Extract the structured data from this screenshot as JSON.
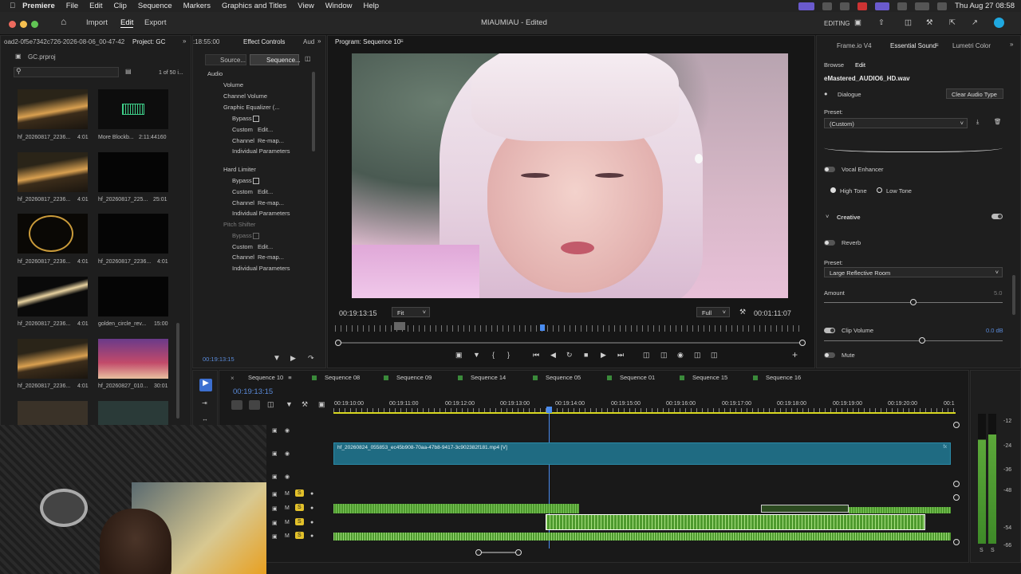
{
  "menubar": {
    "app": "Premiere",
    "items": [
      "File",
      "Edit",
      "Clip",
      "Sequence",
      "Markers",
      "Graphics and Titles",
      "View",
      "Window",
      "Help"
    ],
    "clock": "Thu Aug 27  08:58"
  },
  "titlebar": {
    "home_label": "Home",
    "import_label": "Import",
    "edit_label": "Edit",
    "export_label": "Export",
    "doc_title": "MIAUMIAU - Edited",
    "workspace": "EDITING"
  },
  "project": {
    "tab_label": "Project: GC",
    "path": "oad2-0f5e7342c726-2026-08-06_00-47-42",
    "file": "GC.prproj",
    "count": "1 of 50 i...",
    "search_placeholder": "",
    "items": [
      {
        "name": "hf_20260817_2236...",
        "dur": "4:01"
      },
      {
        "name": "More Blockb...",
        "dur": "2:11:44160"
      },
      {
        "name": "hf_20260817_2236...",
        "dur": "4:01"
      },
      {
        "name": "hf_20260817_225...",
        "dur": "25:01"
      },
      {
        "name": "hf_20260817_2236...",
        "dur": "4:01"
      },
      {
        "name": "hf_20260817_2236...",
        "dur": "4:01"
      },
      {
        "name": "hf_20260817_2236...",
        "dur": "4:01"
      },
      {
        "name": "golden_circle_rev...",
        "dur": "15:00"
      },
      {
        "name": "hf_20260817_2236...",
        "dur": "4:01"
      },
      {
        "name": "hf_20260827_010...",
        "dur": "30:01"
      }
    ]
  },
  "effect_controls": {
    "top_tc": ":18:55:00",
    "tab_label": "Effect Controls",
    "tab_aud": "Aud",
    "source_btn": "Source...",
    "sequence_btn": "Sequence...",
    "audio_header": "Audio",
    "rows": {
      "volume": "Volume",
      "channel_volume": "Channel Volume",
      "graphic_eq": "Graphic Equalizer (...",
      "bypass": "Bypass",
      "custom": "Custom",
      "edit_btn": "Edit...",
      "channel": "Channel",
      "remap": "Re-map...",
      "individual": "Individual Parameters",
      "hard_limiter": "Hard Limiter",
      "pitch_shifter": "Pitch Shifter"
    },
    "bottom_tc": "00:19:13:15"
  },
  "program": {
    "title": "Program: Sequence 10",
    "timecode": "00:19:13:15",
    "fit": "Fit",
    "quality": "Full",
    "duration": "00:01:11:07"
  },
  "essential_sound": {
    "tabs": [
      "Frame.io V4",
      "Essential Sound",
      "Lumetri Color"
    ],
    "browse": "Browse",
    "edit": "Edit",
    "clip_name": "eMastered_AUDIO6_HD.wav",
    "dialogue": "Dialogue",
    "clear_btn": "Clear Audio Type",
    "preset_label": "Preset:",
    "preset_value": "(Custom)",
    "vocal_enhancer": "Vocal Enhancer",
    "high_tone": "High Tone",
    "low_tone": "Low Tone",
    "creative": "Creative",
    "reverb": "Reverb",
    "preset2_label": "Preset:",
    "preset2_value": "Large Reflective Room",
    "amount": "Amount",
    "amount_val": "5.0",
    "clip_volume": "Clip Volume",
    "clip_volume_val": "0.0 dB",
    "mute": "Mute"
  },
  "timeline": {
    "tabs": [
      "Sequence 10",
      "Sequence 08",
      "Sequence 09",
      "Sequence 14",
      "Sequence 05",
      "Sequence 01",
      "Sequence 15",
      "Sequence 16"
    ],
    "tab_colors": [
      "#2c6ad0",
      "#3a8a3a",
      "#3a8a3a",
      "#3a8a3a",
      "#3a8a3a",
      "#3a8a3a",
      "#3a8a3a",
      "#3a8a3a"
    ],
    "timecode": "00:19:13:15",
    "ruler": [
      "00:19:10:00",
      "00:19:11:00",
      "00:19:12:00",
      "00:19:13:00",
      "00:19:14:00",
      "00:19:15:00",
      "00:19:16:00",
      "00:19:17:00",
      "00:19:18:00",
      "00:19:19:00",
      "00:19:20:00",
      "00:1"
    ],
    "video_clip": "hf_20260824_055853_ec45b908-70aa-47b8-9417-3c902382f181.mp4 [V]",
    "track_m": "M",
    "track_s": "S"
  },
  "meter": {
    "labels": [
      "-12",
      "-24",
      "-36",
      "-48",
      "-54",
      "-66"
    ]
  },
  "colors": {
    "accent_blue": "#3c7bd8",
    "timeline_video": "#1f6b82",
    "audio_green": "#4e9a2e",
    "solo_yellow": "#e3c12a"
  }
}
